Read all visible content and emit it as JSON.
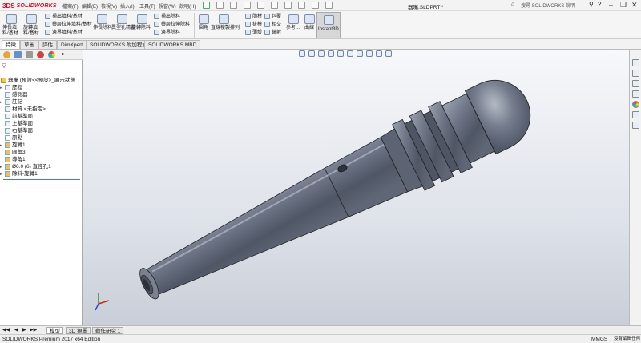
{
  "app": {
    "brand_ds": "3DS",
    "brand_name": "SOLIDWORKS"
  },
  "titlebar": {
    "menus": [
      "檔案(F)",
      "編輯(E)",
      "檢視(V)",
      "插入(I)",
      "工具(T)",
      "視窗(W)",
      "說明(H)"
    ],
    "document_title": "器嘴.SLDPRT *",
    "help_search_placeholder": "搜尋 SOLIDWORKS 說明"
  },
  "commands": {
    "extrude_boss": "伸長填料/基材",
    "revolve_boss": "旋轉填料/基材",
    "sweep_boss": "掃出填料/基材",
    "loft_boss": "疊層拉伸填料/基材",
    "boundary_boss": "邊界填料/基材",
    "extrude_cut": "伸長除料",
    "hole_wizard": "異型孔精靈",
    "revolve_cut": "旋轉除料",
    "sweep_cut": "掃出除料",
    "loft_cut": "疊層拉伸除料",
    "boundary_cut": "邊界除料",
    "fillet": "圓角",
    "linear_pattern": "直線複製排列",
    "rib": "肋材",
    "draft": "拔模",
    "shell": "薄殼",
    "wrap": "包覆",
    "intersect": "相交",
    "mirror": "鏡射",
    "reference": "參考...",
    "curves": "曲線",
    "instant3d": "Instant3D"
  },
  "tabs": [
    "特徵",
    "草圖",
    "評估",
    "DimXpert",
    "SOLIDWORKS 附加程式",
    "SOLIDWORKS MBD"
  ],
  "tree": {
    "root": "器嘴 (預設<<預設>_顯示狀態",
    "items": [
      "歷程",
      "感測器",
      "註記",
      "材質 <未指定>",
      "前基準面",
      "上基準面",
      "右基準面",
      "原點",
      "旋轉1",
      "圓角3",
      "導角1",
      "Ø6.0 (6) 直徑孔1",
      "除料-旋轉1"
    ]
  },
  "bottom_tabs": [
    "模型",
    "3D 視圖",
    "動作研究 1"
  ],
  "statusbar": {
    "edition": "SOLIDWORKS Premium 2017 x64 Edition",
    "units": "MMGS",
    "state": "沒有編輯任何"
  },
  "colors": {
    "brand": "#c8102e",
    "part_body": "#6e7687",
    "viewport_top": "#f7f8fb",
    "viewport_bottom": "#c9ced8"
  }
}
